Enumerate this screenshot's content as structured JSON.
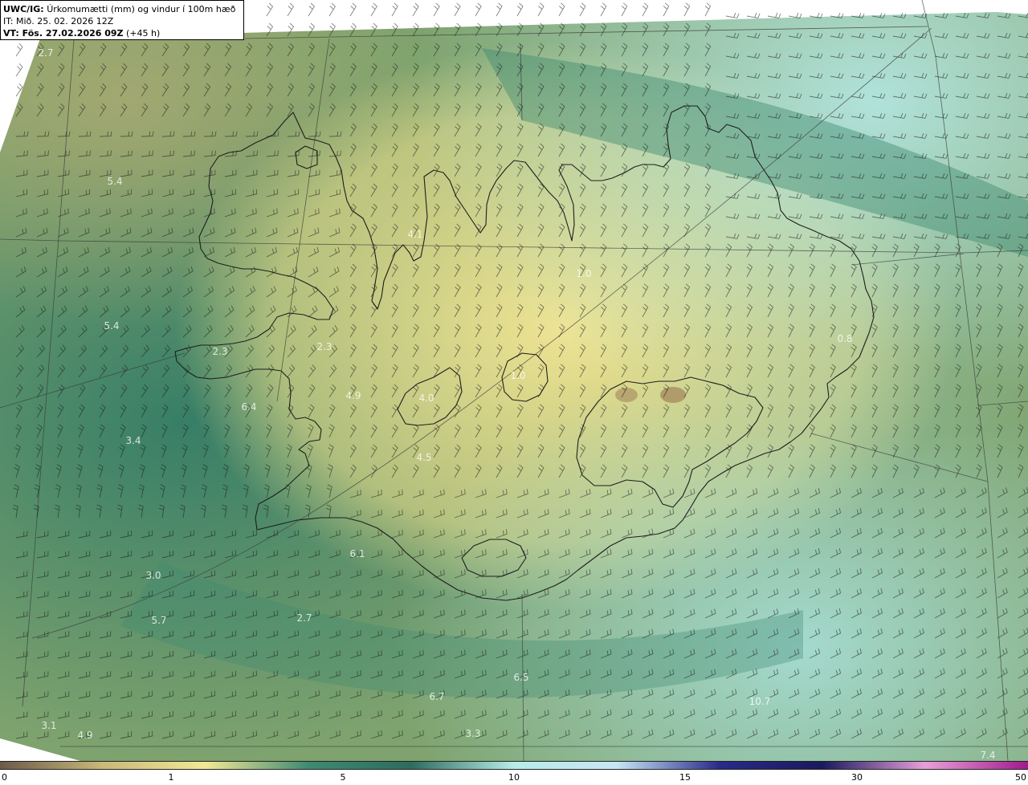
{
  "header": {
    "model": "UWC/IG:",
    "description": "Úrkomumætti (mm) og vindur í 100m hæð",
    "init_time": "IT: Mið. 25. 02. 2026 12Z",
    "valid_time_label": "VT: Fös. 27.02.2026 09Z",
    "lead_time": "(+45 h)"
  },
  "legend": {
    "ticks": [
      "0",
      "1",
      "5",
      "10",
      "15",
      "30",
      "50"
    ],
    "colors": [
      "#6b5a48",
      "#c9b97a",
      "#f2e896",
      "#3f8a72",
      "#2d6b5f",
      "#b6ece8",
      "#c8e6f4",
      "#2a2a8a",
      "#1a1a5e",
      "#e89fd8",
      "#a21a8c"
    ]
  },
  "value_labels": [
    {
      "text": "2.7"
    },
    {
      "text": "5.4"
    },
    {
      "text": "4.1"
    },
    {
      "text": "1.0"
    },
    {
      "text": "5.4"
    },
    {
      "text": "2.3"
    },
    {
      "text": "2.3"
    },
    {
      "text": "0.8"
    },
    {
      "text": "4.9"
    },
    {
      "text": "1.0"
    },
    {
      "text": "4.0"
    },
    {
      "text": "6.4"
    },
    {
      "text": "3.4"
    },
    {
      "text": "4.5"
    },
    {
      "text": "6.1"
    },
    {
      "text": "3.0"
    },
    {
      "text": "5.7"
    },
    {
      "text": "2.7"
    },
    {
      "text": "6.5"
    },
    {
      "text": "6.7"
    },
    {
      "text": "10.7"
    },
    {
      "text": "3.1"
    },
    {
      "text": "4.9"
    },
    {
      "text": "3.3"
    },
    {
      "text": "7.4"
    }
  ],
  "colors": {
    "land_dry": "#efe493",
    "sea_moist": "#2f7a66",
    "high_moist": "#b4e6e0",
    "coastline": "#1e1e1e",
    "grid": "#3a3a3a"
  }
}
